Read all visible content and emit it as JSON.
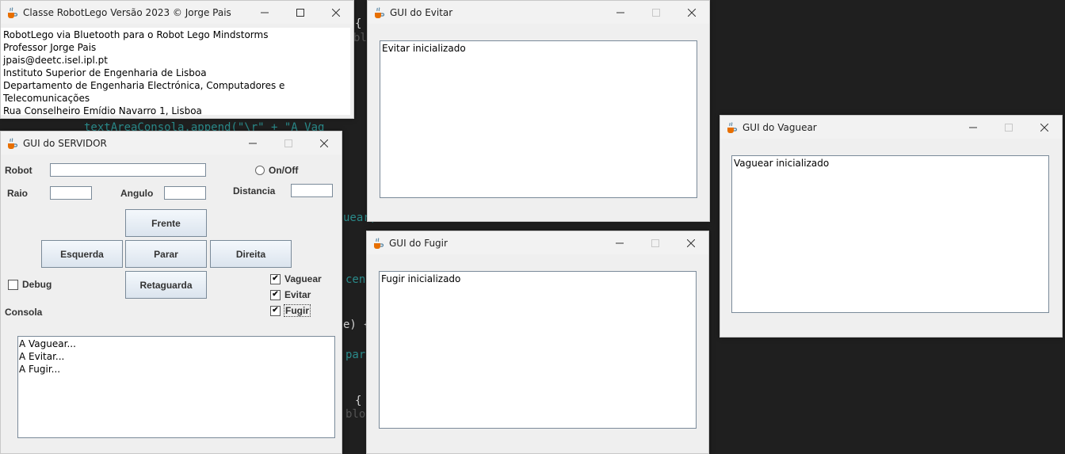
{
  "editor": {
    "fragments": [
      {
        "text": "{",
        "color": "#d4d4d4"
      },
      {
        "text": "blo",
        "color": "#555555"
      },
      {
        "text": "textAreaConsola.append(\"\\r\" + \"A Vag",
        "color": "#2a8a8a"
      },
      {
        "text": "uear,",
        "color": "#2a8a8a"
      },
      {
        "text": "cene",
        "color": "#2a8a8a"
      },
      {
        "text": "e) {",
        "color": "#d4d4d4"
      },
      {
        "text": "par",
        "color": "#2a8a8a"
      },
      {
        "text": "{",
        "color": "#d4d4d4"
      },
      {
        "text": "blo",
        "color": "#555555"
      }
    ]
  },
  "about_window": {
    "title": "Classe RobotLego Versão 2023 © Jorge Pais",
    "lines": [
      "RobotLego via Bluetooth para o Robot Lego Mindstorms",
      "Professor Jorge Pais",
      "jpais@deetc.isel.ipl.pt",
      "Instituto Superior de Engenharia de Lisboa",
      "Departamento de Engenharia Electrónica, Computadores e Telecomunicações",
      "Rua Conselheiro Emídio Navarro 1, Lisboa"
    ]
  },
  "server_window": {
    "title": "GUI do SERVIDOR",
    "robot_label": "Robot",
    "robot_value": "",
    "onoff_label": "On/Off",
    "raio_label": "Raio",
    "raio_value": "",
    "angulo_label": "Angulo",
    "angulo_value": "",
    "distancia_label": "Distancia",
    "distancia_value": "",
    "buttons": {
      "frente": "Frente",
      "esquerda": "Esquerda",
      "parar": "Parar",
      "direita": "Direita",
      "retaguarda": "Retaguarda"
    },
    "debug_label": "Debug",
    "debug_checked": false,
    "behaviours": [
      {
        "label": "Vaguear",
        "checked": true
      },
      {
        "label": "Evitar",
        "checked": true
      },
      {
        "label": "Fugir",
        "checked": true
      }
    ],
    "console_label": "Consola",
    "console_lines": [
      "A Vaguear...",
      "A Evitar...",
      "A Fugir..."
    ]
  },
  "evitar_window": {
    "title": "GUI do Evitar",
    "text": "Evitar inicializado"
  },
  "fugir_window": {
    "title": "GUI do Fugir",
    "text": "Fugir inicializado"
  },
  "vaguear_window": {
    "title": "GUI do Vaguear",
    "text": "Vaguear inicializado"
  },
  "icons": {
    "app": "java-cup-icon",
    "minimize": "minimize-icon",
    "maximize": "maximize-icon",
    "close": "close-icon"
  }
}
